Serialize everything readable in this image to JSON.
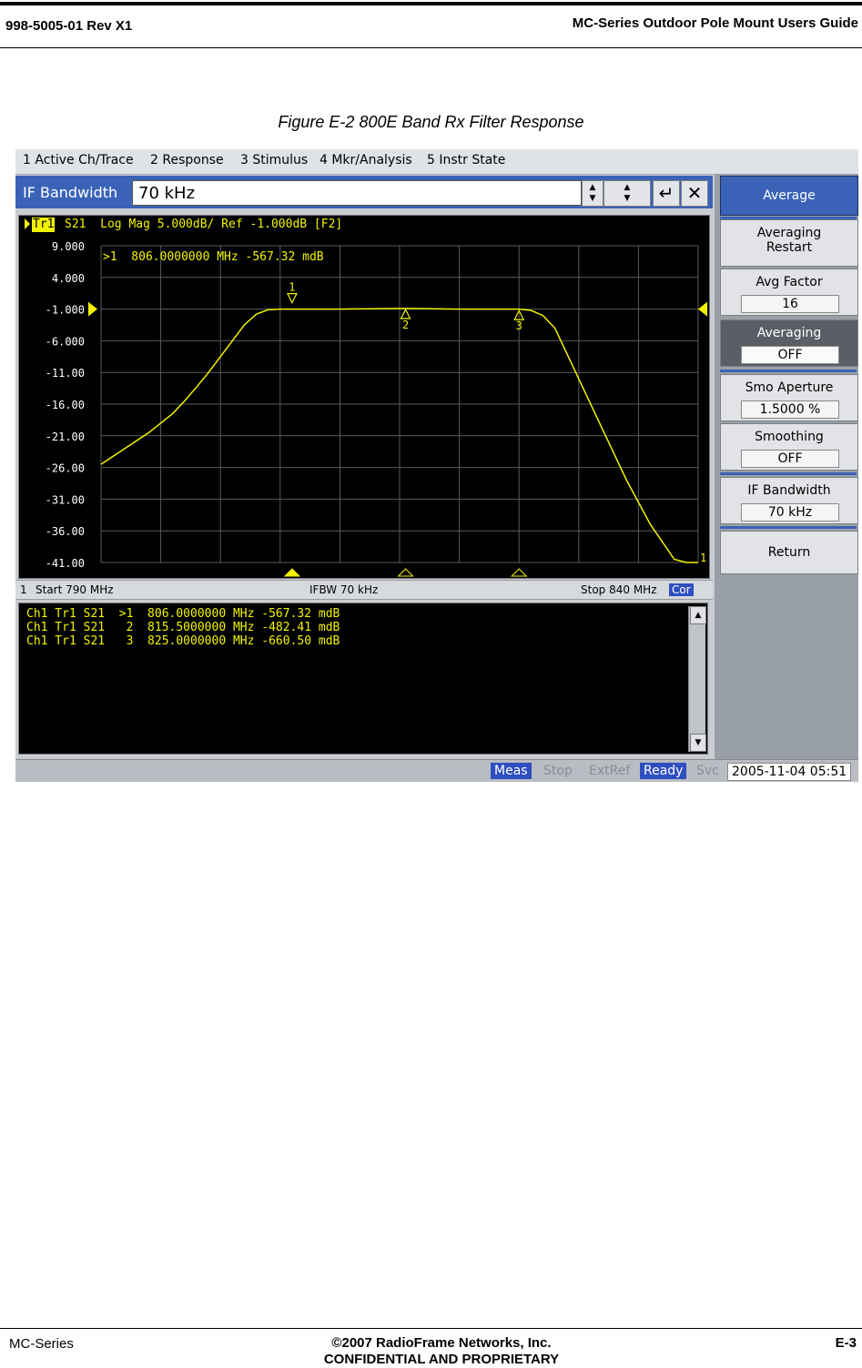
{
  "document": {
    "header_left": "998-5005-01 Rev X1",
    "header_right": "MC-Series Outdoor Pole Mount Users Guide",
    "caption": "Figure E-2  800E Band Rx Filter Response",
    "footer_left": "MC-Series",
    "footer_center_1": "©2007 RadioFrame Networks, Inc.",
    "footer_center_2": "CONFIDENTIAL AND PROPRIETARY",
    "footer_right": "E-3"
  },
  "menu": [
    "1 Active Ch/Trace",
    "2 Response",
    "3 Stimulus",
    "4 Mkr/Analysis",
    "5 Instr State"
  ],
  "entry": {
    "label": "IF Bandwidth",
    "value": "70 kHz",
    "enter_glyph": "↵",
    "close_glyph": "✕"
  },
  "trace": {
    "title": "S21  Log Mag 5.000dB/ Ref -1.000dB [F2]",
    "tag": "Tr1",
    "active_marker": ">1  806.0000000 MHz -567.32 mdB",
    "end_label": "1"
  },
  "channel_status": {
    "channel": "1",
    "start": "Start 790 MHz",
    "ifbw": "IFBW 70 kHz",
    "stop": "Stop 840 MHz",
    "cor": "Cor"
  },
  "marker_table": [
    "Ch1 Tr1 S21  >1  806.0000000 MHz -567.32 mdB",
    "Ch1 Tr1 S21   2  815.5000000 MHz -482.41 mdB",
    "Ch1 Tr1 S21   3  825.0000000 MHz -660.50 mdB"
  ],
  "softkeys": {
    "header": "Average",
    "averaging_restart_1": "Averaging",
    "averaging_restart_2": "Restart",
    "avg_factor": {
      "label": "Avg Factor",
      "value": "16"
    },
    "averaging": {
      "label": "Averaging",
      "value": "OFF"
    },
    "smo_aperture": {
      "label": "Smo Aperture",
      "value": "1.5000  %"
    },
    "smoothing": {
      "label": "Smoothing",
      "value": "OFF"
    },
    "if_bandwidth": {
      "label": "IF Bandwidth",
      "value": "70 kHz"
    },
    "return": "Return"
  },
  "statusbar": {
    "meas": "Meas",
    "stop": "Stop",
    "extref": "ExtRef",
    "ready": "Ready",
    "svc": "Svc",
    "datetime": "2005-11-04 05:51"
  },
  "colors": {
    "trace": "#f2f200",
    "grid": "#5a5a5a",
    "accent": "#3a63b8",
    "plot_bg": "#000000"
  },
  "chart_data": {
    "type": "line",
    "title": "S21  Log Mag 5.000dB/ Ref -1.000dB [F2]",
    "xlabel": "",
    "ylabel": "",
    "xlim": [
      790,
      840
    ],
    "ylim": [
      -41,
      9
    ],
    "yticks": [
      "9.000",
      "4.000",
      "-1.000",
      "-6.000",
      "-11.00",
      "-16.00",
      "-21.00",
      "-26.00",
      "-31.00",
      "-36.00",
      "-41.00"
    ],
    "grid": true,
    "series": [
      {
        "x": [
          790,
          792,
          794,
          796,
          797,
          798,
          799,
          800,
          801,
          802,
          803,
          804,
          805,
          806,
          810,
          815.5,
          820,
          825,
          826,
          827,
          828,
          829,
          830,
          832,
          834,
          836,
          838,
          839,
          840
        ],
        "y": [
          -25.5,
          -23,
          -20.5,
          -17.5,
          -15.5,
          -13.3,
          -11,
          -8.5,
          -6,
          -3.5,
          -1.8,
          -1.1,
          -1,
          -1,
          -1,
          -0.9,
          -1,
          -1,
          -1.2,
          -2,
          -4,
          -8,
          -12,
          -20,
          -28,
          -35,
          -40.5,
          -41,
          -41
        ]
      }
    ],
    "markers": [
      {
        "label": "1",
        "x": 806,
        "y": -0.57
      },
      {
        "label": "2",
        "x": 815.5,
        "y": -0.48
      },
      {
        "label": "3",
        "x": 825,
        "y": -0.66
      }
    ],
    "ref_level": -1
  }
}
